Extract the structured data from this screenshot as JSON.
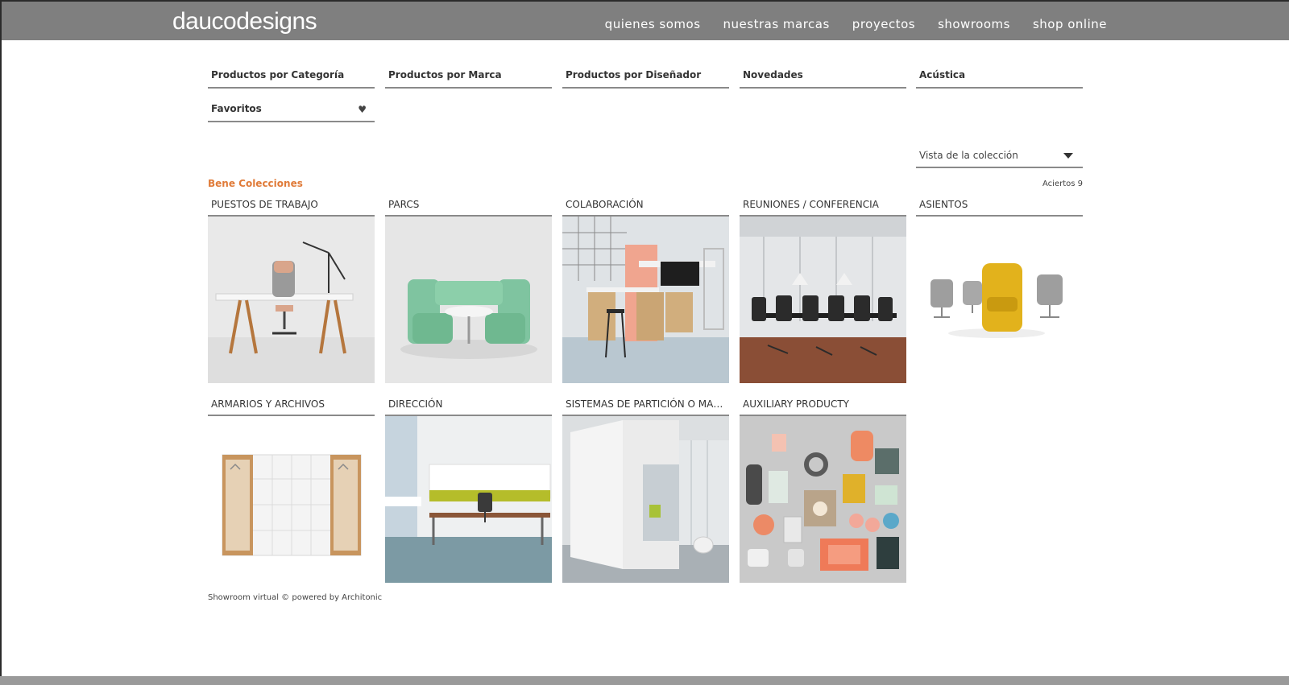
{
  "header": {
    "logo": "daucodesigns",
    "nav": [
      "quienes somos",
      "nuestras marcas",
      "proyectos",
      "showrooms",
      "shop online"
    ]
  },
  "filters": {
    "tabs": [
      "Productos por Categoría",
      "Productos por Marca",
      "Productos por Diseñador",
      "Novedades",
      "Acústica"
    ],
    "favorites": "Favoritos"
  },
  "view_select": {
    "value": "Vista de la colección"
  },
  "collection": {
    "title": "Bene Colecciones",
    "hits": "Aciertos 9",
    "items": [
      "PUESTOS DE TRABAJO",
      "PARCS",
      "COLABORACIÓN",
      "REUNIONES / CONFERENCIA",
      "ASIENTOS",
      "ARMARIOS Y ARCHIVOS",
      "DIRECCIÓN",
      "SISTEMAS DE PARTICIÓN O MAM...",
      "AUXILIARY PRODUCTY"
    ]
  },
  "footer": {
    "note": "Showroom virtual © powered by Architonic"
  },
  "colors": {
    "header_bg": "#7f7f7f",
    "accent": "#e07b39",
    "underline": "#8a8a8a"
  }
}
